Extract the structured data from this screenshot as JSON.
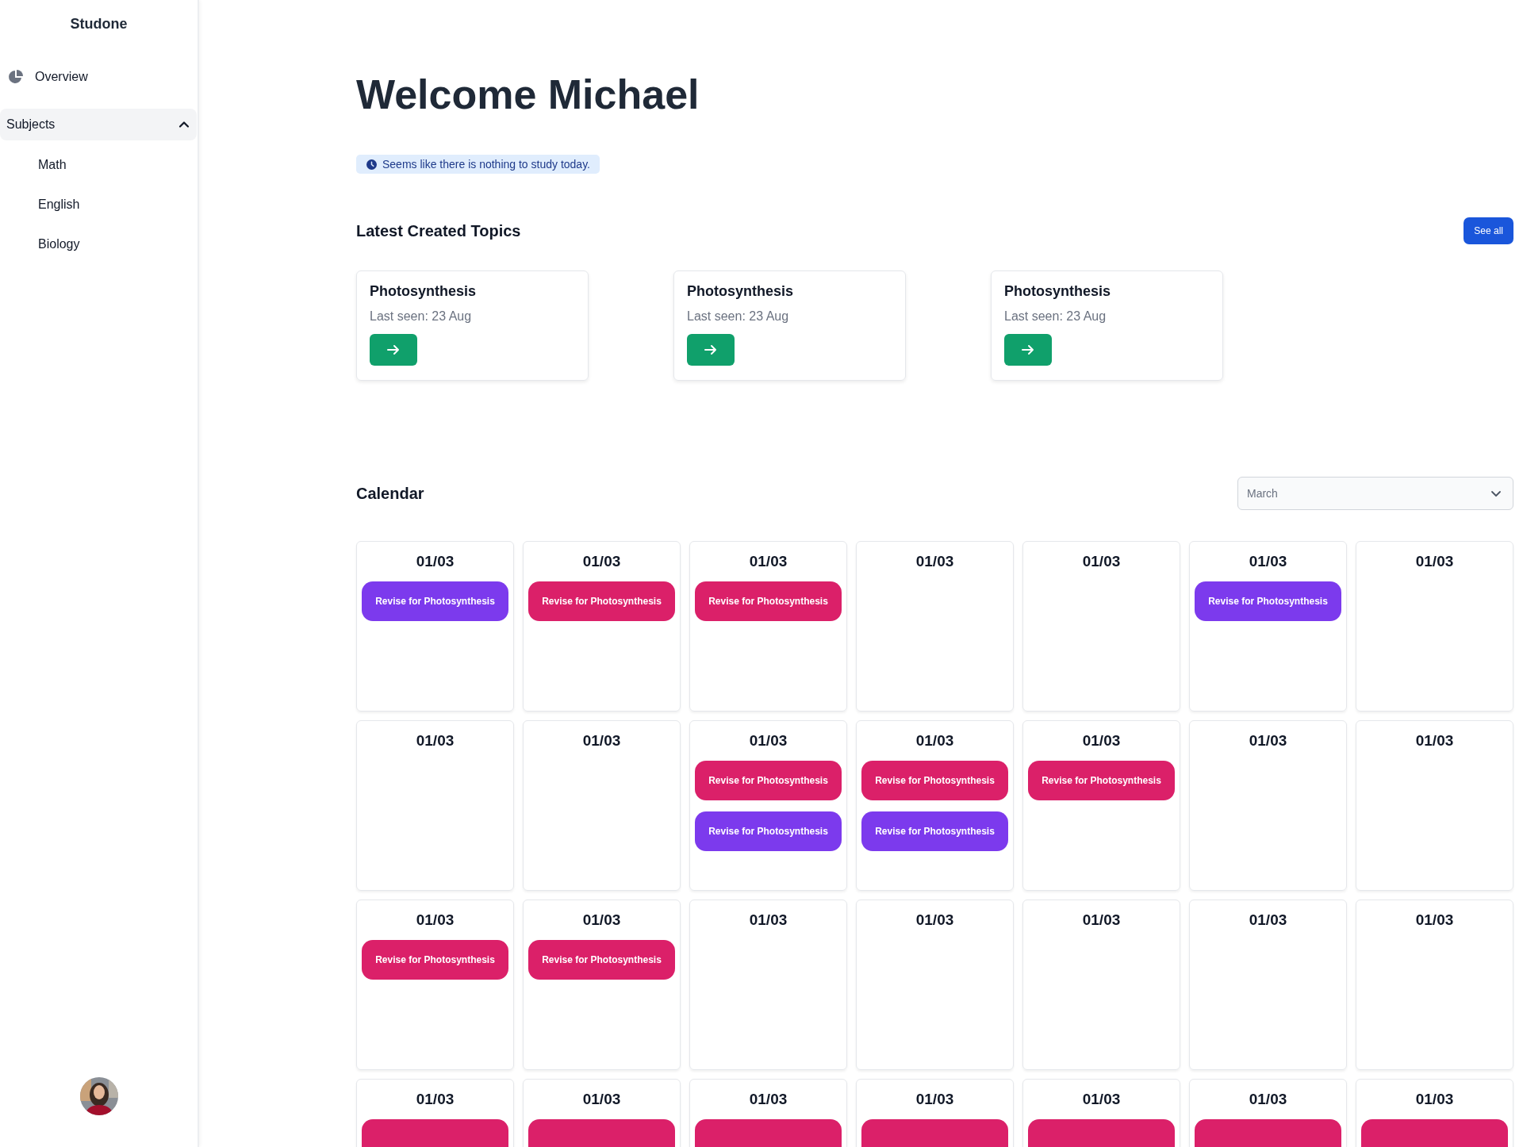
{
  "sidebar": {
    "brand": "Studone",
    "items": [
      {
        "label": "Overview",
        "kind": "link"
      },
      {
        "label": "Subjects",
        "kind": "group",
        "expanded": true,
        "children": [
          {
            "label": "Math"
          },
          {
            "label": "English"
          },
          {
            "label": "Biology"
          }
        ]
      }
    ]
  },
  "header": {
    "title": "Welcome Michael",
    "notice": "Seems like there is nothing to study today."
  },
  "topics": {
    "title": "Latest Created Topics",
    "action": "See all",
    "cards": [
      {
        "title": "Photosynthesis",
        "subtitle": "Last seen: 23 Aug"
      },
      {
        "title": "Photosynthesis",
        "subtitle": "Last seen: 23 Aug"
      },
      {
        "title": "Photosynthesis",
        "subtitle": "Last seen: 23 Aug"
      }
    ]
  },
  "calendar": {
    "title": "Calendar",
    "month_select": {
      "value": "March"
    },
    "days": [
      {
        "date": "01/03",
        "events": [
          {
            "label": "Revise for Photosynthesis",
            "color": "#7c3aed"
          }
        ]
      },
      {
        "date": "01/03",
        "events": [
          {
            "label": "Revise for Photosynthesis",
            "color": "#db2069"
          }
        ]
      },
      {
        "date": "01/03",
        "events": [
          {
            "label": "Revise for Photosynthesis",
            "color": "#db2069"
          }
        ]
      },
      {
        "date": "01/03"
      },
      {
        "date": "01/03"
      },
      {
        "date": "01/03",
        "events": [
          {
            "label": "Revise for Photosynthesis",
            "color": "#7c3aed"
          }
        ]
      },
      {
        "date": "01/03"
      },
      {
        "date": "01/03"
      },
      {
        "date": "01/03"
      },
      {
        "date": "01/03",
        "events": [
          {
            "label": "Revise for Photosynthesis",
            "color": "#db2069"
          },
          {
            "label": "Revise for Photosynthesis",
            "color": "#7c3aed"
          }
        ]
      },
      {
        "date": "01/03",
        "events": [
          {
            "label": "Revise for Photosynthesis",
            "color": "#db2069"
          },
          {
            "label": "Revise for Photosynthesis",
            "color": "#7c3aed"
          }
        ]
      },
      {
        "date": "01/03",
        "events": [
          {
            "label": "Revise for Photosynthesis",
            "color": "#db2069"
          }
        ]
      },
      {
        "date": "01/03"
      },
      {
        "date": "01/03"
      },
      {
        "date": "01/03",
        "events": [
          {
            "label": "Revise for Photosynthesis",
            "color": "#db2069"
          }
        ]
      },
      {
        "date": "01/03",
        "events": [
          {
            "label": "Revise for Photosynthesis",
            "color": "#db2069"
          }
        ]
      },
      {
        "date": "01/03"
      },
      {
        "date": "01/03"
      },
      {
        "date": "01/03"
      },
      {
        "date": "01/03"
      },
      {
        "date": "01/03"
      },
      {
        "date": "01/03",
        "events": [
          {
            "color": "#db2069"
          }
        ]
      },
      {
        "date": "01/03",
        "events": [
          {
            "color": "#db2069"
          }
        ]
      },
      {
        "date": "01/03",
        "events": [
          {
            "color": "#db2069"
          }
        ]
      },
      {
        "date": "01/03",
        "events": [
          {
            "color": "#db2069"
          }
        ]
      },
      {
        "date": "01/03",
        "events": [
          {
            "color": "#db2069"
          }
        ]
      },
      {
        "date": "01/03",
        "events": [
          {
            "color": "#db2069"
          }
        ]
      },
      {
        "date": "01/03",
        "events": [
          {
            "color": "#db2069"
          }
        ]
      }
    ]
  }
}
